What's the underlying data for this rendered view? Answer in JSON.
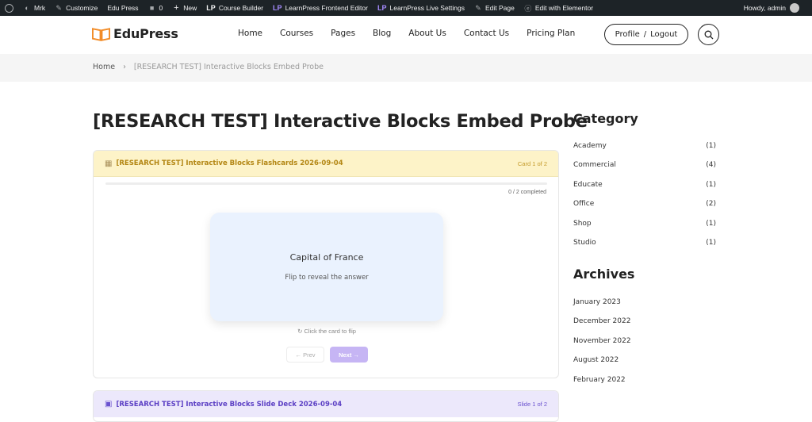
{
  "adminbar": {
    "site_menu": "Mrk",
    "customize": "Customize",
    "site_name": "Edu Press",
    "comments_count": "0",
    "new": "New",
    "course_builder": "Course Builder",
    "lp_frontend_editor": "LearnPress Frontend Editor",
    "lp_live_settings": "LearnPress Live Settings",
    "edit_page": "Edit Page",
    "edit_elementor": "Edit with Elementor",
    "howdy": "Howdy, admin"
  },
  "header": {
    "logo_text": "EduPress",
    "nav": [
      "Home",
      "Courses",
      "Pages",
      "Blog",
      "About Us",
      "Contact Us",
      "Pricing Plan"
    ],
    "profile": "Profile",
    "separator": "/",
    "logout": "Logout"
  },
  "breadcrumb": {
    "home": "Home",
    "current": "[RESEARCH TEST] Interactive Blocks Embed Probe"
  },
  "main": {
    "title": "[RESEARCH TEST] Interactive Blocks Embed Probe",
    "flashcards": {
      "title": "[RESEARCH TEST] Interactive Blocks Flashcards 2026-09-04",
      "counter": "Card 1 of 2",
      "progress_text": "0 / 2 completed",
      "progress": 0,
      "question": "Capital of France",
      "hint": "Flip to reveal the answer",
      "flip_note": "Click the card to flip",
      "prev": "← Prev",
      "next": "Next →"
    },
    "slides": {
      "title": "[RESEARCH TEST] Interactive Blocks Slide Deck 2026-09-04",
      "counter": "Slide 1 of 2"
    }
  },
  "sidebar": {
    "category_heading": "Category",
    "categories": [
      {
        "name": "Academy",
        "count": "(1)"
      },
      {
        "name": "Commercial",
        "count": "(4)"
      },
      {
        "name": "Educate",
        "count": "(1)"
      },
      {
        "name": "Office",
        "count": "(2)"
      },
      {
        "name": "Shop",
        "count": "(1)"
      },
      {
        "name": "Studio",
        "count": "(1)"
      }
    ],
    "archives_heading": "Archives",
    "archives": [
      "January 2023",
      "December 2022",
      "November 2022",
      "August 2022",
      "February 2022"
    ]
  },
  "colors": {
    "accent_orange": "#f28c28",
    "flashcard_header": "#fdf3c8",
    "slide_header": "#ece8fb",
    "next_button": "#c6b5f4"
  }
}
